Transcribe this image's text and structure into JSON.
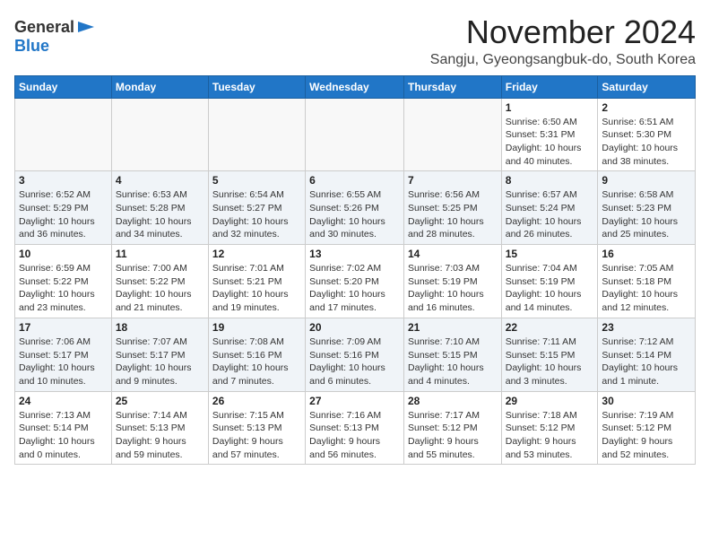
{
  "logo": {
    "general": "General",
    "blue": "Blue"
  },
  "title": "November 2024",
  "subtitle": "Sangju, Gyeongsangbuk-do, South Korea",
  "days_of_week": [
    "Sunday",
    "Monday",
    "Tuesday",
    "Wednesday",
    "Thursday",
    "Friday",
    "Saturday"
  ],
  "weeks": [
    [
      {
        "day": "",
        "info": ""
      },
      {
        "day": "",
        "info": ""
      },
      {
        "day": "",
        "info": ""
      },
      {
        "day": "",
        "info": ""
      },
      {
        "day": "",
        "info": ""
      },
      {
        "day": "1",
        "info": "Sunrise: 6:50 AM\nSunset: 5:31 PM\nDaylight: 10 hours\nand 40 minutes."
      },
      {
        "day": "2",
        "info": "Sunrise: 6:51 AM\nSunset: 5:30 PM\nDaylight: 10 hours\nand 38 minutes."
      }
    ],
    [
      {
        "day": "3",
        "info": "Sunrise: 6:52 AM\nSunset: 5:29 PM\nDaylight: 10 hours\nand 36 minutes."
      },
      {
        "day": "4",
        "info": "Sunrise: 6:53 AM\nSunset: 5:28 PM\nDaylight: 10 hours\nand 34 minutes."
      },
      {
        "day": "5",
        "info": "Sunrise: 6:54 AM\nSunset: 5:27 PM\nDaylight: 10 hours\nand 32 minutes."
      },
      {
        "day": "6",
        "info": "Sunrise: 6:55 AM\nSunset: 5:26 PM\nDaylight: 10 hours\nand 30 minutes."
      },
      {
        "day": "7",
        "info": "Sunrise: 6:56 AM\nSunset: 5:25 PM\nDaylight: 10 hours\nand 28 minutes."
      },
      {
        "day": "8",
        "info": "Sunrise: 6:57 AM\nSunset: 5:24 PM\nDaylight: 10 hours\nand 26 minutes."
      },
      {
        "day": "9",
        "info": "Sunrise: 6:58 AM\nSunset: 5:23 PM\nDaylight: 10 hours\nand 25 minutes."
      }
    ],
    [
      {
        "day": "10",
        "info": "Sunrise: 6:59 AM\nSunset: 5:22 PM\nDaylight: 10 hours\nand 23 minutes."
      },
      {
        "day": "11",
        "info": "Sunrise: 7:00 AM\nSunset: 5:22 PM\nDaylight: 10 hours\nand 21 minutes."
      },
      {
        "day": "12",
        "info": "Sunrise: 7:01 AM\nSunset: 5:21 PM\nDaylight: 10 hours\nand 19 minutes."
      },
      {
        "day": "13",
        "info": "Sunrise: 7:02 AM\nSunset: 5:20 PM\nDaylight: 10 hours\nand 17 minutes."
      },
      {
        "day": "14",
        "info": "Sunrise: 7:03 AM\nSunset: 5:19 PM\nDaylight: 10 hours\nand 16 minutes."
      },
      {
        "day": "15",
        "info": "Sunrise: 7:04 AM\nSunset: 5:19 PM\nDaylight: 10 hours\nand 14 minutes."
      },
      {
        "day": "16",
        "info": "Sunrise: 7:05 AM\nSunset: 5:18 PM\nDaylight: 10 hours\nand 12 minutes."
      }
    ],
    [
      {
        "day": "17",
        "info": "Sunrise: 7:06 AM\nSunset: 5:17 PM\nDaylight: 10 hours\nand 10 minutes."
      },
      {
        "day": "18",
        "info": "Sunrise: 7:07 AM\nSunset: 5:17 PM\nDaylight: 10 hours\nand 9 minutes."
      },
      {
        "day": "19",
        "info": "Sunrise: 7:08 AM\nSunset: 5:16 PM\nDaylight: 10 hours\nand 7 minutes."
      },
      {
        "day": "20",
        "info": "Sunrise: 7:09 AM\nSunset: 5:16 PM\nDaylight: 10 hours\nand 6 minutes."
      },
      {
        "day": "21",
        "info": "Sunrise: 7:10 AM\nSunset: 5:15 PM\nDaylight: 10 hours\nand 4 minutes."
      },
      {
        "day": "22",
        "info": "Sunrise: 7:11 AM\nSunset: 5:15 PM\nDaylight: 10 hours\nand 3 minutes."
      },
      {
        "day": "23",
        "info": "Sunrise: 7:12 AM\nSunset: 5:14 PM\nDaylight: 10 hours\nand 1 minute."
      }
    ],
    [
      {
        "day": "24",
        "info": "Sunrise: 7:13 AM\nSunset: 5:14 PM\nDaylight: 10 hours\nand 0 minutes."
      },
      {
        "day": "25",
        "info": "Sunrise: 7:14 AM\nSunset: 5:13 PM\nDaylight: 9 hours\nand 59 minutes."
      },
      {
        "day": "26",
        "info": "Sunrise: 7:15 AM\nSunset: 5:13 PM\nDaylight: 9 hours\nand 57 minutes."
      },
      {
        "day": "27",
        "info": "Sunrise: 7:16 AM\nSunset: 5:13 PM\nDaylight: 9 hours\nand 56 minutes."
      },
      {
        "day": "28",
        "info": "Sunrise: 7:17 AM\nSunset: 5:12 PM\nDaylight: 9 hours\nand 55 minutes."
      },
      {
        "day": "29",
        "info": "Sunrise: 7:18 AM\nSunset: 5:12 PM\nDaylight: 9 hours\nand 53 minutes."
      },
      {
        "day": "30",
        "info": "Sunrise: 7:19 AM\nSunset: 5:12 PM\nDaylight: 9 hours\nand 52 minutes."
      }
    ]
  ]
}
